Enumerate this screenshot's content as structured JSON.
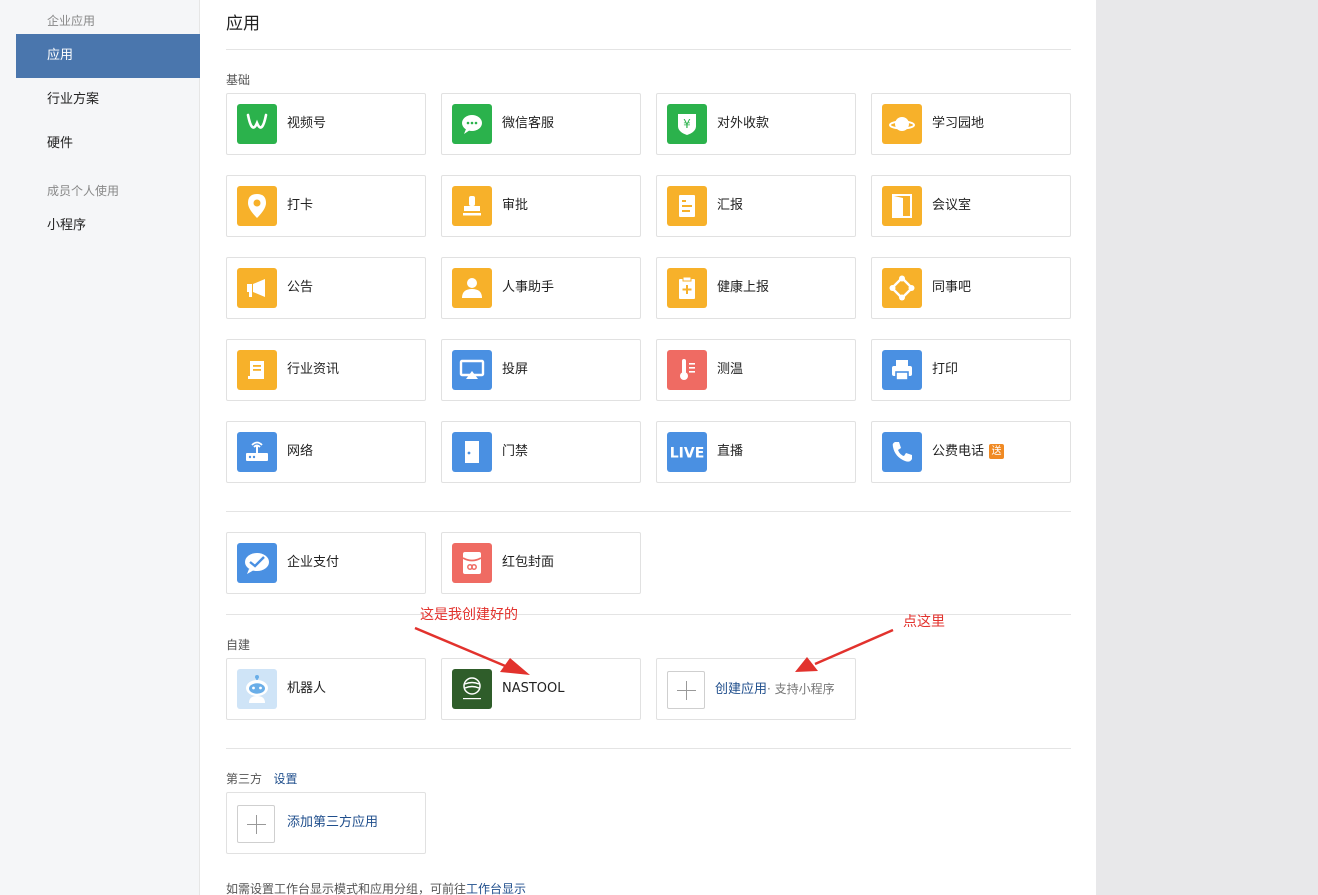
{
  "sidebar": {
    "group1": "企业应用",
    "items": [
      {
        "label": "应用",
        "active": true
      },
      {
        "label": "行业方案"
      },
      {
        "label": "硬件"
      }
    ],
    "group2": "成员个人使用",
    "items2": [
      {
        "label": "小程序"
      }
    ]
  },
  "page": {
    "title": "应用"
  },
  "basic": {
    "label": "基础",
    "apps": [
      {
        "name": "视频号",
        "icon": "video-channel-icon"
      },
      {
        "name": "微信客服",
        "icon": "wechat-service-icon"
      },
      {
        "name": "对外收款",
        "icon": "payment-collect-icon"
      },
      {
        "name": "学习园地",
        "icon": "learning-planet-icon"
      },
      {
        "name": "打卡",
        "icon": "location-pin-icon"
      },
      {
        "name": "审批",
        "icon": "stamp-icon"
      },
      {
        "name": "汇报",
        "icon": "report-icon"
      },
      {
        "name": "会议室",
        "icon": "door-icon"
      },
      {
        "name": "公告",
        "icon": "megaphone-icon"
      },
      {
        "name": "人事助手",
        "icon": "person-icon"
      },
      {
        "name": "健康上报",
        "icon": "health-clipboard-icon"
      },
      {
        "name": "同事吧",
        "icon": "network-icon"
      },
      {
        "name": "行业资讯",
        "icon": "news-scroll-icon"
      },
      {
        "name": "投屏",
        "icon": "screen-cast-icon"
      },
      {
        "name": "测温",
        "icon": "thermometer-icon"
      },
      {
        "name": "打印",
        "icon": "printer-icon"
      },
      {
        "name": "网络",
        "icon": "router-icon"
      },
      {
        "name": "门禁",
        "icon": "door-access-icon"
      },
      {
        "name": "直播",
        "icon": "live-icon"
      },
      {
        "name": "公费电话",
        "icon": "phone-icon",
        "badge": "送"
      }
    ]
  },
  "extra": {
    "apps": [
      {
        "name": "企业支付",
        "icon": "wechat-pay-icon"
      },
      {
        "name": "红包封面",
        "icon": "red-packet-icon"
      }
    ]
  },
  "custom": {
    "label": "自建",
    "apps": [
      {
        "name": "机器人",
        "icon": "robot-icon"
      },
      {
        "name": "NASTOOL",
        "icon": "nastool-logo-icon"
      }
    ],
    "create": {
      "label": "创建应用",
      "sub": "· 支持小程序"
    }
  },
  "third": {
    "label": "第三方",
    "settings": "设置",
    "add": "添加第三方应用"
  },
  "footer": {
    "text": "如需设置工作台显示模式和应用分组，可前往",
    "link": "工作台显示"
  },
  "annotations": {
    "left": "这是我创建好的",
    "right": "点这里",
    "color": "#e2322d"
  },
  "colors": {
    "accent": "#4a76ad",
    "yellow": "#f7b12a",
    "green": "#2bb24c",
    "blue": "#4a90e2",
    "red": "#ef6b63"
  }
}
